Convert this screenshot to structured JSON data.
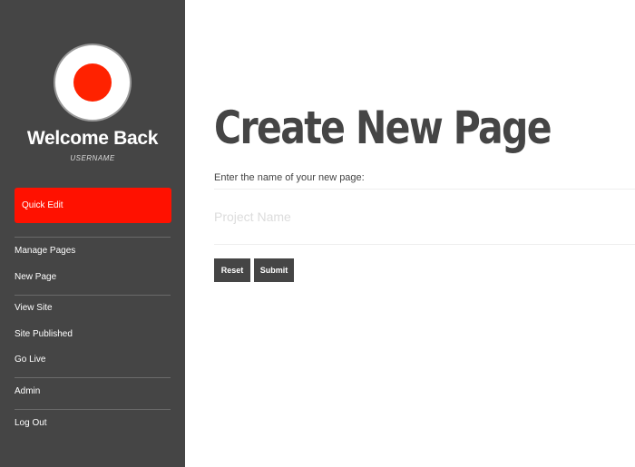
{
  "sidebar": {
    "welcome": "Welcome Back",
    "username": "USERNAME",
    "quick_edit": "Quick Edit",
    "items": [
      {
        "label": "Manage Pages"
      },
      {
        "label": "New Page"
      },
      {
        "label": "View Site"
      },
      {
        "label": "Site Published"
      },
      {
        "label": "Go Live"
      },
      {
        "label": "Admin"
      },
      {
        "label": "Log Out"
      }
    ]
  },
  "main": {
    "title": "Create New Page",
    "prompt": "Enter the name of your new page:",
    "input_placeholder": "Project Name",
    "input_value": "",
    "reset_label": "Reset",
    "submit_label": "Submit"
  },
  "colors": {
    "sidebar_bg": "#454545",
    "accent": "#ff1100",
    "button_bg": "#454545"
  }
}
